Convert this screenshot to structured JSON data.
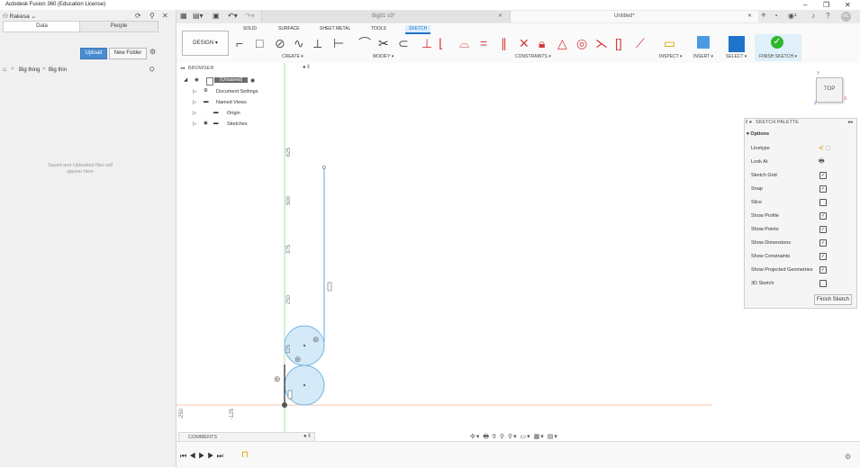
{
  "app": {
    "title": "Autodesk Fusion 360 (Education License)",
    "window_controls": [
      "–",
      "❐",
      "✕"
    ]
  },
  "datapanel": {
    "user": "Rakesa",
    "tabs": [
      "Data",
      "People"
    ],
    "upload_label": "Upload",
    "new_folder_label": "New Folder",
    "breadcrumb": [
      "Big thing",
      "Big thin"
    ],
    "empty_message": "Saved and Uploaded files will appear here"
  },
  "tabs": {
    "doc1": "Big01 v3*",
    "doc2": "Untitled*"
  },
  "toolbar": {
    "design_label": "DESIGN ▾",
    "workspace_tabs": [
      "SOLID",
      "SURFACE",
      "SHEET METAL",
      "TOOLS",
      "SKETCH"
    ],
    "active_tab": "SKETCH",
    "groups": {
      "create": "CREATE ▾",
      "modify": "MODIFY ▾",
      "constraints": "CONSTRAINTS ▾",
      "inspect": "INSPECT ▾",
      "insert": "INSERT ▾",
      "select": "SELECT ▾",
      "finish": "FINISH SKETCH ▾"
    }
  },
  "browser": {
    "title": "BROWSER",
    "root": "(Unsaved)",
    "items": [
      "Document Settings",
      "Named Views",
      "Origin",
      "Sketches"
    ]
  },
  "viewcube": {
    "face": "TOP",
    "axis_y": "Y",
    "axis_x": "X",
    "axis_z": "Z"
  },
  "palette": {
    "title": "SKETCH PALETTE",
    "section": "Options",
    "rows": [
      {
        "label": "Linetype",
        "checked": false
      },
      {
        "label": "Look At",
        "checked": false
      },
      {
        "label": "Sketch Grid",
        "checked": true
      },
      {
        "label": "Snap",
        "checked": true
      },
      {
        "label": "Slice",
        "checked": false
      },
      {
        "label": "Show Profile",
        "checked": true
      },
      {
        "label": "Show Points",
        "checked": true
      },
      {
        "label": "Show Dimensions",
        "checked": true
      },
      {
        "label": "Show Constraints",
        "checked": true
      },
      {
        "label": "Show Projected Geometries",
        "checked": true
      },
      {
        "label": "3D Sketch",
        "checked": false
      }
    ],
    "finish_label": "Finish Sketch"
  },
  "ruler": {
    "vertical": [
      "625",
      "500",
      "375",
      "250",
      "125"
    ],
    "horizontal": [
      "-250",
      "-125"
    ]
  },
  "comments_label": "COMMENTS",
  "colors": {
    "accent": "#1f73c9",
    "finish_green": "#2eb82e",
    "sketch_line": "#76b7e6",
    "fill": "#d4eaf8",
    "axis_green": "#8fd48f",
    "axis_red": "#f0a080"
  }
}
